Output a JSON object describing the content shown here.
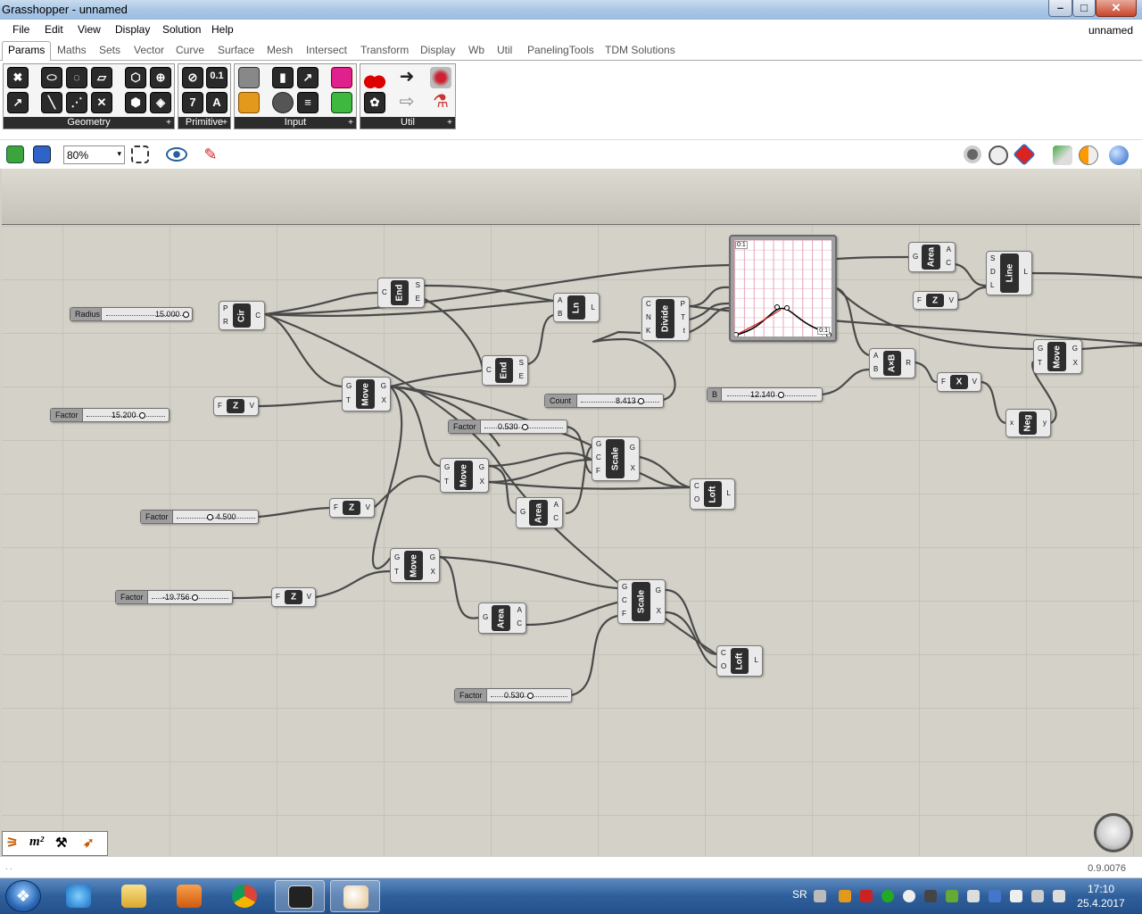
{
  "window": {
    "title": "Grasshopper - unnamed",
    "min": "–",
    "max": "□",
    "close": "✕"
  },
  "menu": {
    "items": [
      "File",
      "Edit",
      "View",
      "Display",
      "Solution",
      "Help"
    ],
    "document": "unnamed"
  },
  "tabs": [
    "Params",
    "Maths",
    "Sets",
    "Vector",
    "Curve",
    "Surface",
    "Mesh",
    "Intersect",
    "Transform",
    "Display",
    "Wb",
    "Util",
    "PanelingTools",
    "TDM Solutions"
  ],
  "ribbon": {
    "groups": [
      {
        "label": "Geometry",
        "more": "+"
      },
      {
        "label": "Primitive",
        "more": "+"
      },
      {
        "label": "Input",
        "more": "+"
      },
      {
        "label": "Util",
        "more": "+"
      }
    ],
    "primitive_glyphs": [
      "0.1",
      "7",
      "A"
    ]
  },
  "toolbar": {
    "zoom": "80%",
    "zoom_dd": "▾"
  },
  "components": {
    "cir": {
      "name": "Cir",
      "in": [
        "P",
        "R"
      ],
      "out": [
        "C"
      ]
    },
    "end1": {
      "name": "End",
      "in": [
        "C"
      ],
      "out": [
        "S",
        "E"
      ]
    },
    "ln": {
      "name": "Ln",
      "in": [
        "A",
        "B"
      ],
      "out": [
        "L"
      ]
    },
    "divide": {
      "name": "Divide",
      "in": [
        "C",
        "N",
        "K"
      ],
      "out": [
        "P",
        "T",
        "t"
      ]
    },
    "area1": {
      "name": "Area",
      "in": [
        "G"
      ],
      "out": [
        "A",
        "C"
      ]
    },
    "z1": {
      "name": "Z",
      "in": [
        "F"
      ],
      "out": [
        "V"
      ]
    },
    "line": {
      "name": "Line",
      "in": [
        "S",
        "D",
        "L"
      ],
      "out": [
        "L"
      ]
    },
    "end2": {
      "name": "End",
      "in": [
        "C"
      ],
      "out": [
        "S",
        "E"
      ]
    },
    "move1": {
      "name": "Move",
      "in": [
        "G",
        "T"
      ],
      "out": [
        "G",
        "X"
      ]
    },
    "z2": {
      "name": "Z",
      "in": [
        "F"
      ],
      "out": [
        "V"
      ]
    },
    "axb": {
      "name": "A×B",
      "in": [
        "A",
        "B"
      ],
      "out": [
        "R"
      ]
    },
    "x1": {
      "name": "X",
      "in": [
        "F"
      ],
      "out": [
        "V"
      ]
    },
    "move2": {
      "name": "Move",
      "in": [
        "G",
        "T"
      ],
      "out": [
        "G",
        "X"
      ]
    },
    "neg": {
      "name": "Neg",
      "in": [
        "x"
      ],
      "out": [
        "y"
      ]
    },
    "scale1": {
      "name": "Scale",
      "in": [
        "G",
        "C",
        "F"
      ],
      "out": [
        "G",
        "X"
      ]
    },
    "move3": {
      "name": "Move",
      "in": [
        "G",
        "T"
      ],
      "out": [
        "G",
        "X"
      ]
    },
    "loft1": {
      "name": "Loft",
      "in": [
        "C",
        "O"
      ],
      "out": [
        "L"
      ]
    },
    "area2": {
      "name": "Area",
      "in": [
        "G"
      ],
      "out": [
        "A",
        "C"
      ]
    },
    "z3": {
      "name": "Z",
      "in": [
        "F"
      ],
      "out": [
        "V"
      ]
    },
    "move4": {
      "name": "Move",
      "in": [
        "G",
        "T"
      ],
      "out": [
        "G",
        "X"
      ]
    },
    "z4": {
      "name": "Z",
      "in": [
        "F"
      ],
      "out": [
        "V"
      ]
    },
    "scale2": {
      "name": "Scale",
      "in": [
        "G",
        "C",
        "F"
      ],
      "out": [
        "G",
        "X"
      ]
    },
    "area3": {
      "name": "Area",
      "in": [
        "G"
      ],
      "out": [
        "A",
        "C"
      ]
    },
    "loft2": {
      "name": "Loft",
      "in": [
        "C",
        "O"
      ],
      "out": [
        "L"
      ]
    }
  },
  "sliders": {
    "radius": {
      "label": "Radius",
      "value": "15.000"
    },
    "factor1": {
      "label": "Factor",
      "value": "15.200"
    },
    "count": {
      "label": "Count",
      "value": "8.413"
    },
    "b": {
      "label": "B",
      "value": "12.140"
    },
    "factor2": {
      "label": "Factor",
      "value": "0.530"
    },
    "factor3": {
      "label": "Factor",
      "value": "4.500"
    },
    "factor4": {
      "label": "Factor",
      "value": "-19.756"
    },
    "factor5": {
      "label": "Factor",
      "value": "0.530"
    }
  },
  "graph": {
    "corner_label": "0:1",
    "corner_label2": "0:1"
  },
  "bottom": {
    "m2": "m²"
  },
  "status": {
    "version": "0.9.0076",
    "dots": ". ."
  },
  "taskbar": {
    "lang": "SR",
    "time": "17:10",
    "date": "25.4.2017"
  }
}
